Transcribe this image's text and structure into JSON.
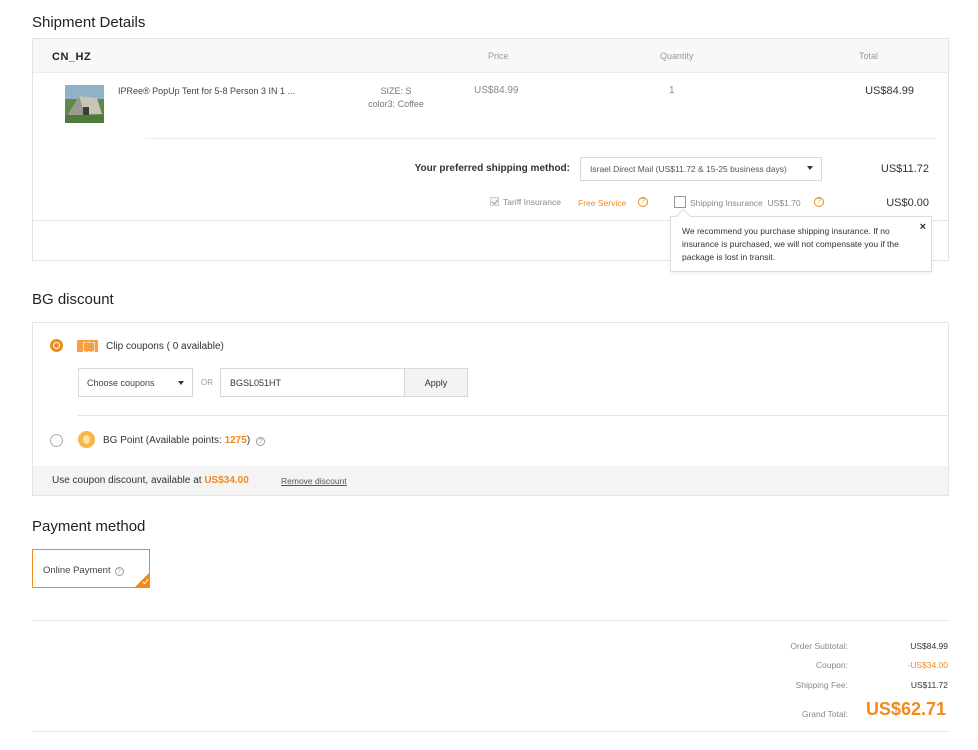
{
  "shipment": {
    "title": "Shipment Details",
    "warehouse": "CN_HZ",
    "columns": {
      "price": "Price",
      "quantity": "Quantity",
      "total": "Total"
    },
    "item": {
      "name": "IPRee® PopUp Tent for 5-8 Person 3 IN 1 ...",
      "size": "SIZE: S",
      "color": "color3: Coffee",
      "price": "US$84.99",
      "quantity": "1",
      "total": "US$84.99"
    },
    "method_label": "Your preferred shipping method:",
    "method_value": "Israel Direct Mail (US$11.72 & 15-25 business days)",
    "shipping_fee": "US$11.72",
    "tariff_label": "Tariff Insurance",
    "tariff_value": "Free Service",
    "insurance_label": "Shipping Insurance",
    "insurance_price": "US$1.70",
    "insurance_fee": "US$0.00",
    "tooltip": "We recommend you purchase shipping insurance. If no insurance is purchased, we will not compensate you if the package is lost in transit.",
    "tooltip_close": "×"
  },
  "discount": {
    "title": "BG discount",
    "clip_label": "Clip coupons ( 0 available)",
    "choose_label": "Choose coupons",
    "or_label": "OR",
    "code_value": "BGSL051HT",
    "apply_label": "Apply",
    "bgpoint_prefix": "BG Point (Available points: ",
    "bgpoint_value": "1275",
    "bgpoint_suffix": ")",
    "footer_text": "Use coupon discount, available at ",
    "footer_amount": "US$34.00",
    "remove_label": "Remove discount"
  },
  "payment": {
    "title": "Payment method",
    "option_label": "Online Payment"
  },
  "summary": {
    "subtotal_label": "Order Subtotal:",
    "subtotal_value": "US$84.99",
    "coupon_label": "Coupon:",
    "coupon_value": "-US$34.00",
    "shipping_label": "Shipping Fee:",
    "shipping_value": "US$11.72",
    "grand_label": "Grand Total:",
    "grand_value": "US$62.71"
  },
  "colors": {
    "accent": "#f08a1d",
    "border": "#e3e3e3"
  },
  "icons": {
    "help": "question-circle-icon",
    "coupon": "coupon-ticket-icon",
    "bgpoint": "coin-icon"
  }
}
